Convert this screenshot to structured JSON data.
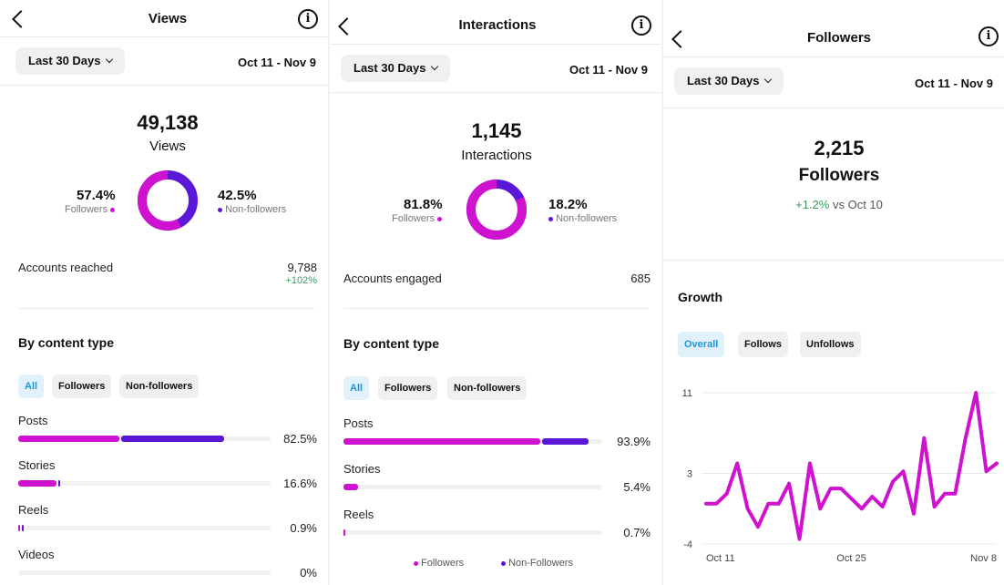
{
  "colors": {
    "followers": "#cf12cf",
    "non_followers": "#5a17d8",
    "positive": "#3a9a5b",
    "selected_chip": "#1e95d9"
  },
  "views": {
    "title": "Views",
    "date_filter": "Last 30 Days",
    "date_range": "Oct 11 - Nov 9",
    "total": "49,138",
    "total_label": "Views",
    "followers_pct": "57.4%",
    "followers_label": "Followers",
    "non_followers_pct": "42.5%",
    "non_followers_label": "Non-followers",
    "donut": {
      "followers_share": 0.574
    },
    "metric_label": "Accounts reached",
    "metric_value": "9,788",
    "metric_change": "+102%",
    "section_title": "By content type",
    "chips": [
      "All",
      "Followers",
      "Non-followers"
    ],
    "content_rows": [
      {
        "label": "Posts",
        "value": "82.5%",
        "followers_share": 0.4,
        "non_followers_share": 0.41
      },
      {
        "label": "Stories",
        "value": "16.6%",
        "followers_share": 0.15,
        "non_followers_share": 0.01
      },
      {
        "label": "Reels",
        "value": "0.9%",
        "followers_share": 0.008,
        "non_followers_share": 0.003
      },
      {
        "label": "Videos",
        "value": "0%",
        "followers_share": 0,
        "non_followers_share": 0
      }
    ]
  },
  "interactions": {
    "title": "Interactions",
    "date_filter": "Last 30 Days",
    "date_range": "Oct 11 - Nov 9",
    "total": "1,145",
    "total_label": "Interactions",
    "followers_pct": "81.8%",
    "followers_label": "Followers",
    "non_followers_pct": "18.2%",
    "non_followers_label": "Non-followers",
    "donut": {
      "followers_share": 0.818
    },
    "metric_label": "Accounts engaged",
    "metric_value": "685",
    "section_title": "By content type",
    "chips": [
      "All",
      "Followers",
      "Non-followers"
    ],
    "content_rows": [
      {
        "label": "Posts",
        "value": "93.9%",
        "followers_share": 0.76,
        "non_followers_share": 0.18
      },
      {
        "label": "Stories",
        "value": "5.4%",
        "followers_share": 0.055,
        "non_followers_share": 0
      },
      {
        "label": "Reels",
        "value": "0.7%",
        "followers_share": 0.007,
        "non_followers_share": 0
      }
    ],
    "footer_legend": [
      "Followers",
      "Non-Followers"
    ]
  },
  "followers": {
    "title": "Followers",
    "date_filter": "Last 30 Days",
    "date_range": "Oct 11 - Nov 9",
    "total": "2,215",
    "total_label": "Followers",
    "change": "+1.2%",
    "change_suffix": "vs Oct 10",
    "section_title": "Growth",
    "chips": [
      "Overall",
      "Follows",
      "Unfollows"
    ],
    "chart_data": {
      "type": "line",
      "title": "Growth",
      "series": [
        {
          "values": [
            0,
            0,
            1,
            4,
            -0.5,
            -2.3,
            0,
            0,
            2,
            -3.5,
            4,
            -0.5,
            1.5,
            1.5,
            0.5,
            -0.5,
            0.7,
            -0.3,
            2.2,
            3.2,
            -1,
            6.5,
            -0.3,
            1,
            1,
            6.5,
            11,
            3.2,
            4
          ]
        }
      ],
      "yticks": [
        "11",
        "3",
        "-4"
      ],
      "ylim": [
        -4,
        11
      ],
      "xticks": [
        "Oct 11",
        "Oct 25",
        "Nov 8"
      ],
      "x_start": "Oct 11",
      "x_end": "Nov 8",
      "grid": true
    }
  }
}
